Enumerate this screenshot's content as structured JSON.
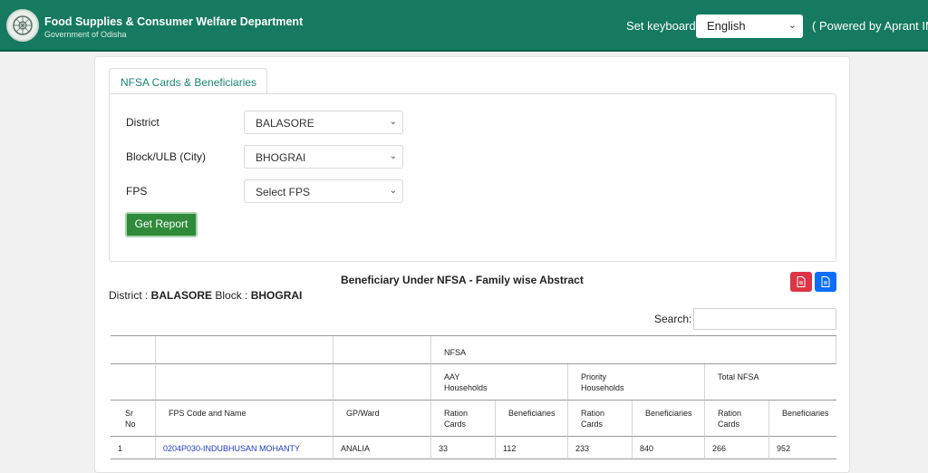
{
  "header": {
    "title": "Food Supplies & Consumer Welfare Department",
    "subtitle": "Government of Odisha",
    "keyboard_label": "Set keyboard",
    "language": "English",
    "powered_by": "( Powered by Aprant IMB"
  },
  "tab": {
    "label": "NFSA Cards & Beneficiaries"
  },
  "form": {
    "district_label": "District",
    "district_value": "BALASORE",
    "block_label": "Block/ULB (City)",
    "block_value": "BHOGRAI",
    "fps_label": "FPS",
    "fps_value": "Select FPS",
    "submit_label": "Get Report"
  },
  "report": {
    "title": "Beneficiary Under NFSA - Family wise Abstract",
    "district_prefix": "District : ",
    "district": "BALASORE",
    "block_prefix": " Block : ",
    "block": "BHOGRAI",
    "search_label": "Search:",
    "colors": {
      "pdf": "#dc3545",
      "doc": "#0d6efd"
    }
  },
  "table": {
    "group_header": "NFSA",
    "aay": [
      "AAY",
      "Households"
    ],
    "priority": [
      "Priority",
      "Households"
    ],
    "total": "Total NFSA",
    "sr": [
      "Sr",
      "No"
    ],
    "fps": "FPS Code and Name",
    "gp": "GP/Ward",
    "ration_cards": [
      "Ration",
      "Cards"
    ],
    "beneficiaries": "Beneficiaries",
    "rows": [
      {
        "sr": "1",
        "fps": "0204P030-INDUBHUSAN MOHANTY",
        "gp": "ANALIA",
        "aay_cards": "33",
        "aay_ben": "112",
        "pri_cards": "233",
        "pri_ben": "840",
        "tot_cards": "266",
        "tot_ben": "952"
      }
    ]
  }
}
